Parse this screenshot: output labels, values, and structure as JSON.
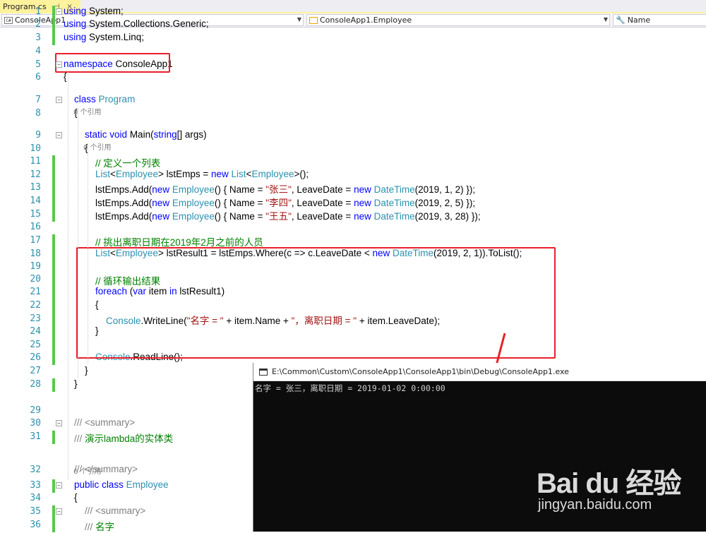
{
  "tab": {
    "title": "Program.cs",
    "pin": "⊣",
    "close": "×"
  },
  "nav": {
    "project": "ConsoleApp1",
    "project_icon": "C#",
    "type": "ConsoleApp1.Employee",
    "member": "Name"
  },
  "line_numbers": [
    "1",
    "2",
    "3",
    "4",
    "5",
    "6",
    "7",
    "8",
    "9",
    "10",
    "11",
    "12",
    "13",
    "14",
    "15",
    "16",
    "17",
    "18",
    "19",
    "20",
    "21",
    "22",
    "23",
    "24",
    "25",
    "26",
    "27",
    "28",
    "29",
    "30",
    "31",
    "32",
    "33",
    "34",
    "35",
    "36"
  ],
  "code_lines": [
    [
      {
        "t": "using",
        "c": "kw"
      },
      {
        "t": " System;",
        "c": ""
      }
    ],
    [
      {
        "t": "using",
        "c": "kw"
      },
      {
        "t": " System.Collections.Generic;",
        "c": ""
      }
    ],
    [
      {
        "t": "using",
        "c": "kw"
      },
      {
        "t": " System.Linq;",
        "c": ""
      }
    ],
    [],
    [
      {
        "t": "namespace",
        "c": "kw"
      },
      {
        "t": " ConsoleApp1",
        "c": ""
      }
    ],
    [
      {
        "t": "{",
        "c": ""
      }
    ],
    [
      {
        "t": "    ",
        "c": ""
      },
      {
        "t": "class",
        "c": "kw"
      },
      {
        "t": " ",
        "c": ""
      },
      {
        "t": "Program",
        "c": "ty"
      }
    ],
    [
      {
        "t": "    {",
        "c": ""
      }
    ],
    [
      {
        "t": "        ",
        "c": ""
      },
      {
        "t": "static",
        "c": "kw"
      },
      {
        "t": " ",
        "c": ""
      },
      {
        "t": "void",
        "c": "kw"
      },
      {
        "t": " Main(",
        "c": ""
      },
      {
        "t": "string",
        "c": "kw"
      },
      {
        "t": "[] args)",
        "c": ""
      }
    ],
    [
      {
        "t": "        {",
        "c": ""
      }
    ],
    [
      {
        "t": "            ",
        "c": ""
      },
      {
        "t": "// 定义一个列表",
        "c": "cm"
      }
    ],
    [
      {
        "t": "            ",
        "c": ""
      },
      {
        "t": "List",
        "c": "ty"
      },
      {
        "t": "<",
        "c": ""
      },
      {
        "t": "Employee",
        "c": "ty"
      },
      {
        "t": "> lstEmps = ",
        "c": ""
      },
      {
        "t": "new",
        "c": "kw"
      },
      {
        "t": " ",
        "c": ""
      },
      {
        "t": "List",
        "c": "ty"
      },
      {
        "t": "<",
        "c": ""
      },
      {
        "t": "Employee",
        "c": "ty"
      },
      {
        "t": ">();",
        "c": ""
      }
    ],
    [
      {
        "t": "            lstEmps.Add(",
        "c": ""
      },
      {
        "t": "new",
        "c": "kw"
      },
      {
        "t": " ",
        "c": ""
      },
      {
        "t": "Employee",
        "c": "ty"
      },
      {
        "t": "() { Name = ",
        "c": ""
      },
      {
        "t": "\"张三\"",
        "c": "str"
      },
      {
        "t": ", LeaveDate = ",
        "c": ""
      },
      {
        "t": "new",
        "c": "kw"
      },
      {
        "t": " ",
        "c": ""
      },
      {
        "t": "DateTime",
        "c": "ty"
      },
      {
        "t": "(2019, 1, 2) });",
        "c": ""
      }
    ],
    [
      {
        "t": "            lstEmps.Add(",
        "c": ""
      },
      {
        "t": "new",
        "c": "kw"
      },
      {
        "t": " ",
        "c": ""
      },
      {
        "t": "Employee",
        "c": "ty"
      },
      {
        "t": "() { Name = ",
        "c": ""
      },
      {
        "t": "\"李四\"",
        "c": "str"
      },
      {
        "t": ", LeaveDate = ",
        "c": ""
      },
      {
        "t": "new",
        "c": "kw"
      },
      {
        "t": " ",
        "c": ""
      },
      {
        "t": "DateTime",
        "c": "ty"
      },
      {
        "t": "(2019, 2, 5) });",
        "c": ""
      }
    ],
    [
      {
        "t": "            lstEmps.Add(",
        "c": ""
      },
      {
        "t": "new",
        "c": "kw"
      },
      {
        "t": " ",
        "c": ""
      },
      {
        "t": "Employee",
        "c": "ty"
      },
      {
        "t": "() { Name = ",
        "c": ""
      },
      {
        "t": "\"王五\"",
        "c": "str"
      },
      {
        "t": ", LeaveDate = ",
        "c": ""
      },
      {
        "t": "new",
        "c": "kw"
      },
      {
        "t": " ",
        "c": ""
      },
      {
        "t": "DateTime",
        "c": "ty"
      },
      {
        "t": "(2019, 3, 28) });",
        "c": ""
      }
    ],
    [],
    [
      {
        "t": "            ",
        "c": ""
      },
      {
        "t": "// 挑出离职日期在2019年2月之前的人员",
        "c": "cm"
      }
    ],
    [
      {
        "t": "            ",
        "c": ""
      },
      {
        "t": "List",
        "c": "ty"
      },
      {
        "t": "<",
        "c": ""
      },
      {
        "t": "Employee",
        "c": "ty"
      },
      {
        "t": "> lstResult1 = lstEmps.Where(c => c.LeaveDate < ",
        "c": ""
      },
      {
        "t": "new",
        "c": "kw"
      },
      {
        "t": " ",
        "c": ""
      },
      {
        "t": "DateTime",
        "c": "ty"
      },
      {
        "t": "(2019, 2, 1)).ToList();",
        "c": ""
      }
    ],
    [],
    [
      {
        "t": "            ",
        "c": ""
      },
      {
        "t": "// 循环输出结果",
        "c": "cm"
      }
    ],
    [
      {
        "t": "            ",
        "c": ""
      },
      {
        "t": "foreach",
        "c": "kw"
      },
      {
        "t": " (",
        "c": ""
      },
      {
        "t": "var",
        "c": "kw"
      },
      {
        "t": " item ",
        "c": ""
      },
      {
        "t": "in",
        "c": "kw"
      },
      {
        "t": " lstResult1)",
        "c": ""
      }
    ],
    [
      {
        "t": "            {",
        "c": ""
      }
    ],
    [
      {
        "t": "                ",
        "c": ""
      },
      {
        "t": "Console",
        "c": "ty"
      },
      {
        "t": ".WriteLine(",
        "c": ""
      },
      {
        "t": "\"名字 = \"",
        "c": "str"
      },
      {
        "t": " + item.Name + ",
        "c": ""
      },
      {
        "t": "\"，离职日期 = \"",
        "c": "str"
      },
      {
        "t": " + item.LeaveDate);",
        "c": ""
      }
    ],
    [
      {
        "t": "            }",
        "c": ""
      }
    ],
    [],
    [
      {
        "t": "            ",
        "c": ""
      },
      {
        "t": "Console",
        "c": "ty"
      },
      {
        "t": ".ReadLine();",
        "c": ""
      }
    ],
    [
      {
        "t": "        }",
        "c": ""
      }
    ],
    [
      {
        "t": "    }",
        "c": ""
      }
    ],
    [],
    [
      {
        "t": "    ",
        "c": ""
      },
      {
        "t": "/// <summary>",
        "c": "gy"
      }
    ],
    [
      {
        "t": "    ",
        "c": ""
      },
      {
        "t": "///",
        "c": "gy"
      },
      {
        "t": " 演示lambda的实体类",
        "c": "cm"
      }
    ],
    [
      {
        "t": "    ",
        "c": ""
      },
      {
        "t": "/// </summary>",
        "c": "gy"
      }
    ],
    [
      {
        "t": "    ",
        "c": ""
      },
      {
        "t": "public",
        "c": "kw"
      },
      {
        "t": " ",
        "c": ""
      },
      {
        "t": "class",
        "c": "kw"
      },
      {
        "t": " ",
        "c": ""
      },
      {
        "t": "Employee",
        "c": "ty"
      }
    ],
    [
      {
        "t": "    {",
        "c": ""
      }
    ],
    [
      {
        "t": "        ",
        "c": ""
      },
      {
        "t": "/// <summary>",
        "c": "gy"
      }
    ],
    [
      {
        "t": "        ",
        "c": ""
      },
      {
        "t": "///",
        "c": "gy"
      },
      {
        "t": " 名字",
        "c": "cm"
      }
    ]
  ],
  "hints": {
    "program_refs": "0 个引用",
    "main_refs": "0 个引用",
    "employee_refs": "6 个引用"
  },
  "console": {
    "title": "E:\\Common\\Custom\\ConsoleApp1\\ConsoleApp1\\bin\\Debug\\ConsoleApp1.exe",
    "output": "名字 = 张三，离职日期 = 2019-01-02 0:00:00"
  },
  "watermark": {
    "logo": "Bai du 经验",
    "url": "jingyan.baidu.com"
  },
  "colors": {
    "keyword": "#0000ff",
    "type": "#2b91af",
    "string": "#a31515",
    "comment": "#008000",
    "change_bar": "#57c84d",
    "highlight_box": "#e8202a",
    "tab_active": "#fff29d"
  }
}
